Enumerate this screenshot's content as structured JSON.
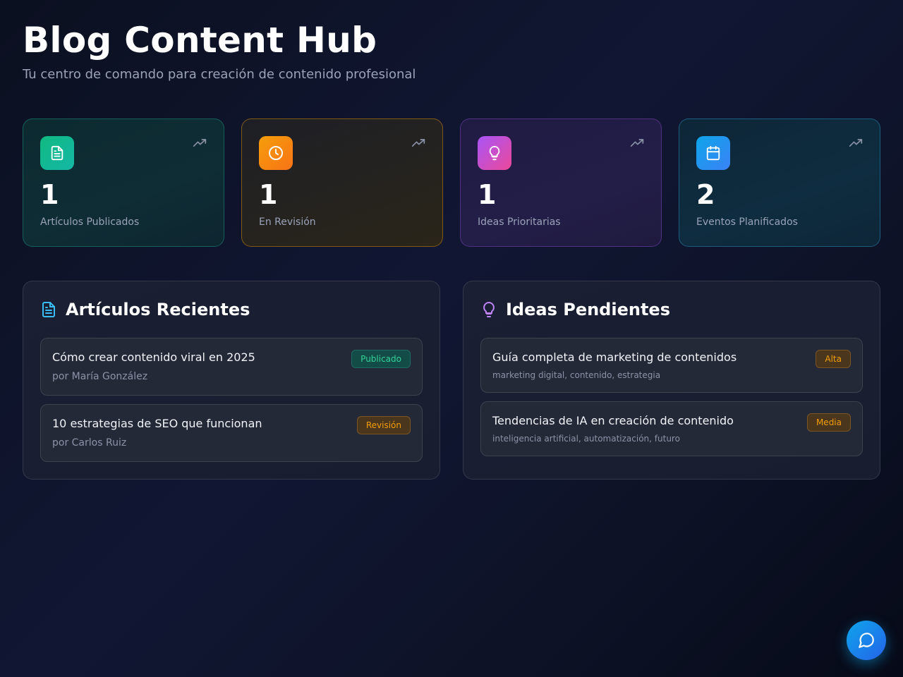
{
  "header": {
    "title": "Blog Content Hub",
    "subtitle": "Tu centro de comando para creación de contenido profesional"
  },
  "stats": [
    {
      "value": "1",
      "label": "Artículos Publicados",
      "icon": "document-icon",
      "color": "#10b981"
    },
    {
      "value": "1",
      "label": "En Revisión",
      "icon": "clock-icon",
      "color": "#f59e0b"
    },
    {
      "value": "1",
      "label": "Ideas Prioritarias",
      "icon": "lightbulb-icon",
      "color": "#a855f7"
    },
    {
      "value": "2",
      "label": "Eventos Planificados",
      "icon": "calendar-icon",
      "color": "#0ea5e9"
    }
  ],
  "recent_articles": {
    "title": "Artículos Recientes",
    "icon": "document-icon",
    "items": [
      {
        "title": "Cómo crear contenido viral en 2025",
        "author": "por María González",
        "status": "Publicado",
        "status_color": "#34d399"
      },
      {
        "title": "10 estrategias de SEO que funcionan",
        "author": "por Carlos Ruiz",
        "status": "Revisión",
        "status_color": "#f59e0b"
      }
    ]
  },
  "pending_ideas": {
    "title": "Ideas Pendientes",
    "icon": "lightbulb-icon",
    "items": [
      {
        "title": "Guía completa de marketing de contenidos",
        "tags": "marketing digital, contenido, estrategia",
        "priority": "Alta",
        "priority_color": "#f59e0b"
      },
      {
        "title": "Tendencias de IA en creación de contenido",
        "tags": "inteligencia artificial, automatización, futuro",
        "priority": "Media",
        "priority_color": "#f59e0b"
      }
    ]
  },
  "chat_button": {
    "icon": "chat-bubble-icon"
  }
}
